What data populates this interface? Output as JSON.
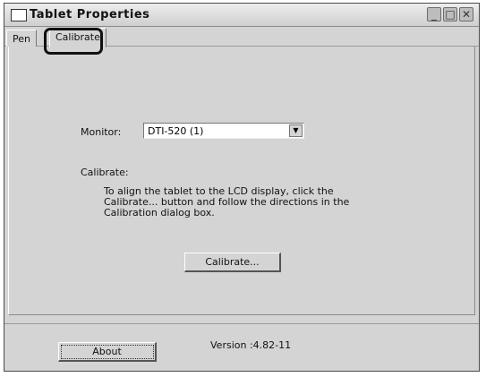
{
  "window": {
    "title": "Tablet Properties",
    "controls": {
      "minimize": "_",
      "maximize": "□",
      "close": "✕"
    }
  },
  "tabs": [
    {
      "label": "Pen",
      "active": false
    },
    {
      "label": "Calibrate",
      "active": true
    }
  ],
  "main": {
    "monitor_label": "Monitor:",
    "monitor_value": "DTI-520 (1)",
    "calibrate_heading": "Calibrate:",
    "instructions": "To align the tablet to the LCD display, click the Calibrate... button and follow the directions in the Calibration dialog box.",
    "calibrate_button": "Calibrate..."
  },
  "footer": {
    "about_button": "About",
    "version": "Version :4.82-11"
  },
  "icons": {
    "dropdown_arrow": "chevron-down-icon"
  }
}
